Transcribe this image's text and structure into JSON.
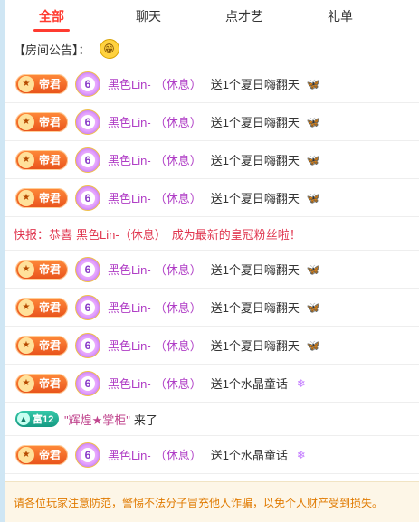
{
  "tabs": [
    {
      "label": "全部"
    },
    {
      "label": "聊天"
    },
    {
      "label": "点才艺"
    },
    {
      "label": "礼单"
    }
  ],
  "notice": {
    "label": "【房间公告】："
  },
  "badges": {
    "emperor": "帝君",
    "level": "6",
    "rich": "富12"
  },
  "messages": [
    {
      "user": "黑色Lin-",
      "status": "（休息）",
      "action": "送1个夏日嗨翻天",
      "gift_icon": "butterfly-gift-icon"
    },
    {
      "user": "黑色Lin-",
      "status": "（休息）",
      "action": "送1个夏日嗨翻天",
      "gift_icon": "butterfly-gift-icon"
    },
    {
      "user": "黑色Lin-",
      "status": "（休息）",
      "action": "送1个夏日嗨翻天",
      "gift_icon": "butterfly-gift-icon"
    },
    {
      "user": "黑色Lin-",
      "status": "（休息）",
      "action": "送1个夏日嗨翻天",
      "gift_icon": "butterfly-gift-icon"
    }
  ],
  "flash": {
    "prefix": "快报：恭喜",
    "user": "黑色Lin-（休息）",
    "suffix": "成为最新的皇冠粉丝啦！"
  },
  "messages2": [
    {
      "user": "黑色Lin-",
      "status": "（休息）",
      "action": "送1个夏日嗨翻天",
      "gift_icon": "butterfly-gift-icon"
    },
    {
      "user": "黑色Lin-",
      "status": "（休息）",
      "action": "送1个夏日嗨翻天",
      "gift_icon": "butterfly-gift-icon"
    },
    {
      "user": "黑色Lin-",
      "status": "（休息）",
      "action": "送1个夏日嗨翻天",
      "gift_icon": "butterfly-gift-icon"
    },
    {
      "user": "黑色Lin-",
      "status": "（休息）",
      "action": "送1个水晶童话",
      "gift_icon": "crystal-gift-icon"
    }
  ],
  "enter": {
    "name": "\"辉煌★掌柜\"",
    "tail": "来了"
  },
  "last": {
    "user": "黑色Lin-",
    "status": "（休息）",
    "action": "送1个水晶童话",
    "gift_icon": "crystal-gift-icon"
  },
  "footer": {
    "text": "请各位玩家注意防范，警惕不法分子冒充他人诈骗，以免个人财产受到损失。"
  },
  "colors": {
    "accent": "#ff3b30",
    "username": "#b03ec6",
    "flash": "#e0364f",
    "footer": "#e07a00"
  }
}
